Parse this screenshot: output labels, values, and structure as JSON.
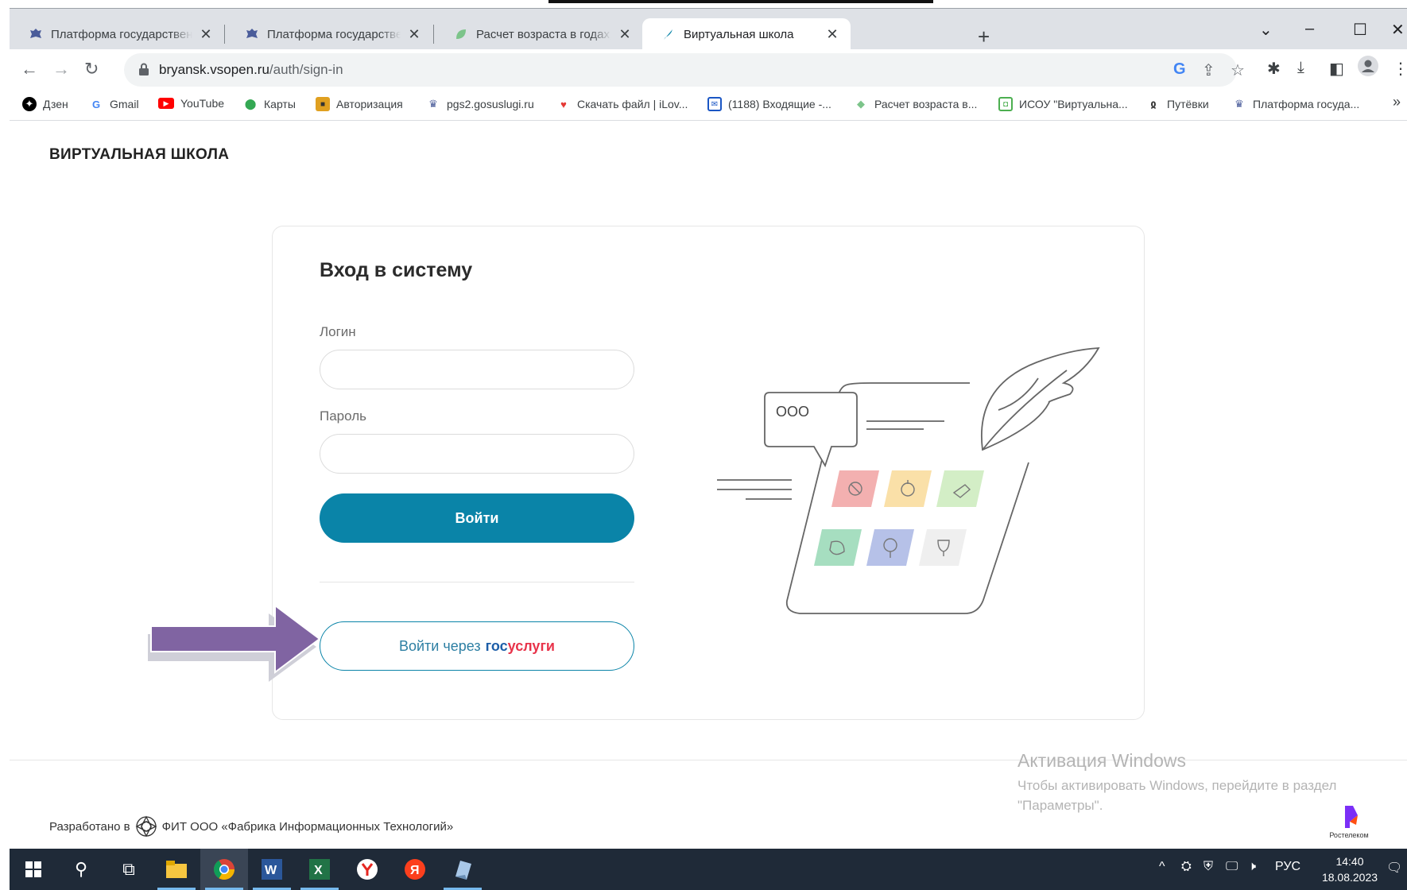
{
  "browser": {
    "tabs": [
      {
        "title": "Платформа государственных сервисов",
        "active": false
      },
      {
        "title": "Платформа государственных сервисов",
        "active": false
      },
      {
        "title": "Расчет возраста в годах, месяцах и днях",
        "active": false
      },
      {
        "title": "Виртуальная школа",
        "active": true
      }
    ],
    "new_tab": "+",
    "address": {
      "host": "bryansk.vsopen.ru",
      "path": "/auth/sign-in"
    },
    "bookmarks": [
      {
        "label": "Дзен",
        "icon": "dzen-icon"
      },
      {
        "label": "Gmail",
        "icon": "google-icon"
      },
      {
        "label": "YouTube",
        "icon": "youtube-icon"
      },
      {
        "label": "Карты",
        "icon": "maps-pin-icon"
      },
      {
        "label": "Авторизация",
        "icon": "authorization-icon"
      },
      {
        "label": "pgs2.gosuslugi.ru",
        "icon": "eagle-icon"
      },
      {
        "label": "Скачать файл | iLov...",
        "icon": "heart-icon"
      },
      {
        "label": "(1188) Входящие -...",
        "icon": "mail-icon"
      },
      {
        "label": "Расчет возраста в...",
        "icon": "leaf-icon"
      },
      {
        "label": "ИСОУ \"Виртуальна...",
        "icon": "isou-icon"
      },
      {
        "label": "Путёвки",
        "icon": "tickets-icon"
      },
      {
        "label": "Платформа госуда...",
        "icon": "eagle-icon"
      }
    ],
    "bookmarks_overflow": "»"
  },
  "page": {
    "brand": "ВИРТУАЛЬНАЯ ШКОЛА",
    "login_card": {
      "title": "Вход в систему",
      "login_label": "Логин",
      "login_value": "",
      "password_label": "Пароль",
      "password_value": "",
      "submit_label": "Войти",
      "gosuslugi_prefix": "Войти через",
      "gosuslugi_gos": "гос",
      "gosuslugi_uslugi": "услуги"
    },
    "illustration_bubble": "OOO",
    "footer": {
      "developed_by": "Разработано в",
      "company": "ФИТ ООО «Фабрика Информационных Технологий»",
      "rostelecom": "Ростелеком"
    }
  },
  "watermark": {
    "title": "Активация Windows",
    "text": "Чтобы активировать Windows, перейдите в раздел \"Параметры\"."
  },
  "taskbar": {
    "language": "РУС",
    "time": "14:40",
    "date": "18.08.2023"
  },
  "colors": {
    "primary": "#0a84a8",
    "gos_blue": "#1d5ea8",
    "gos_red": "#e8334a",
    "arrow": "#8064a2",
    "taskbar": "#1f2a38"
  }
}
